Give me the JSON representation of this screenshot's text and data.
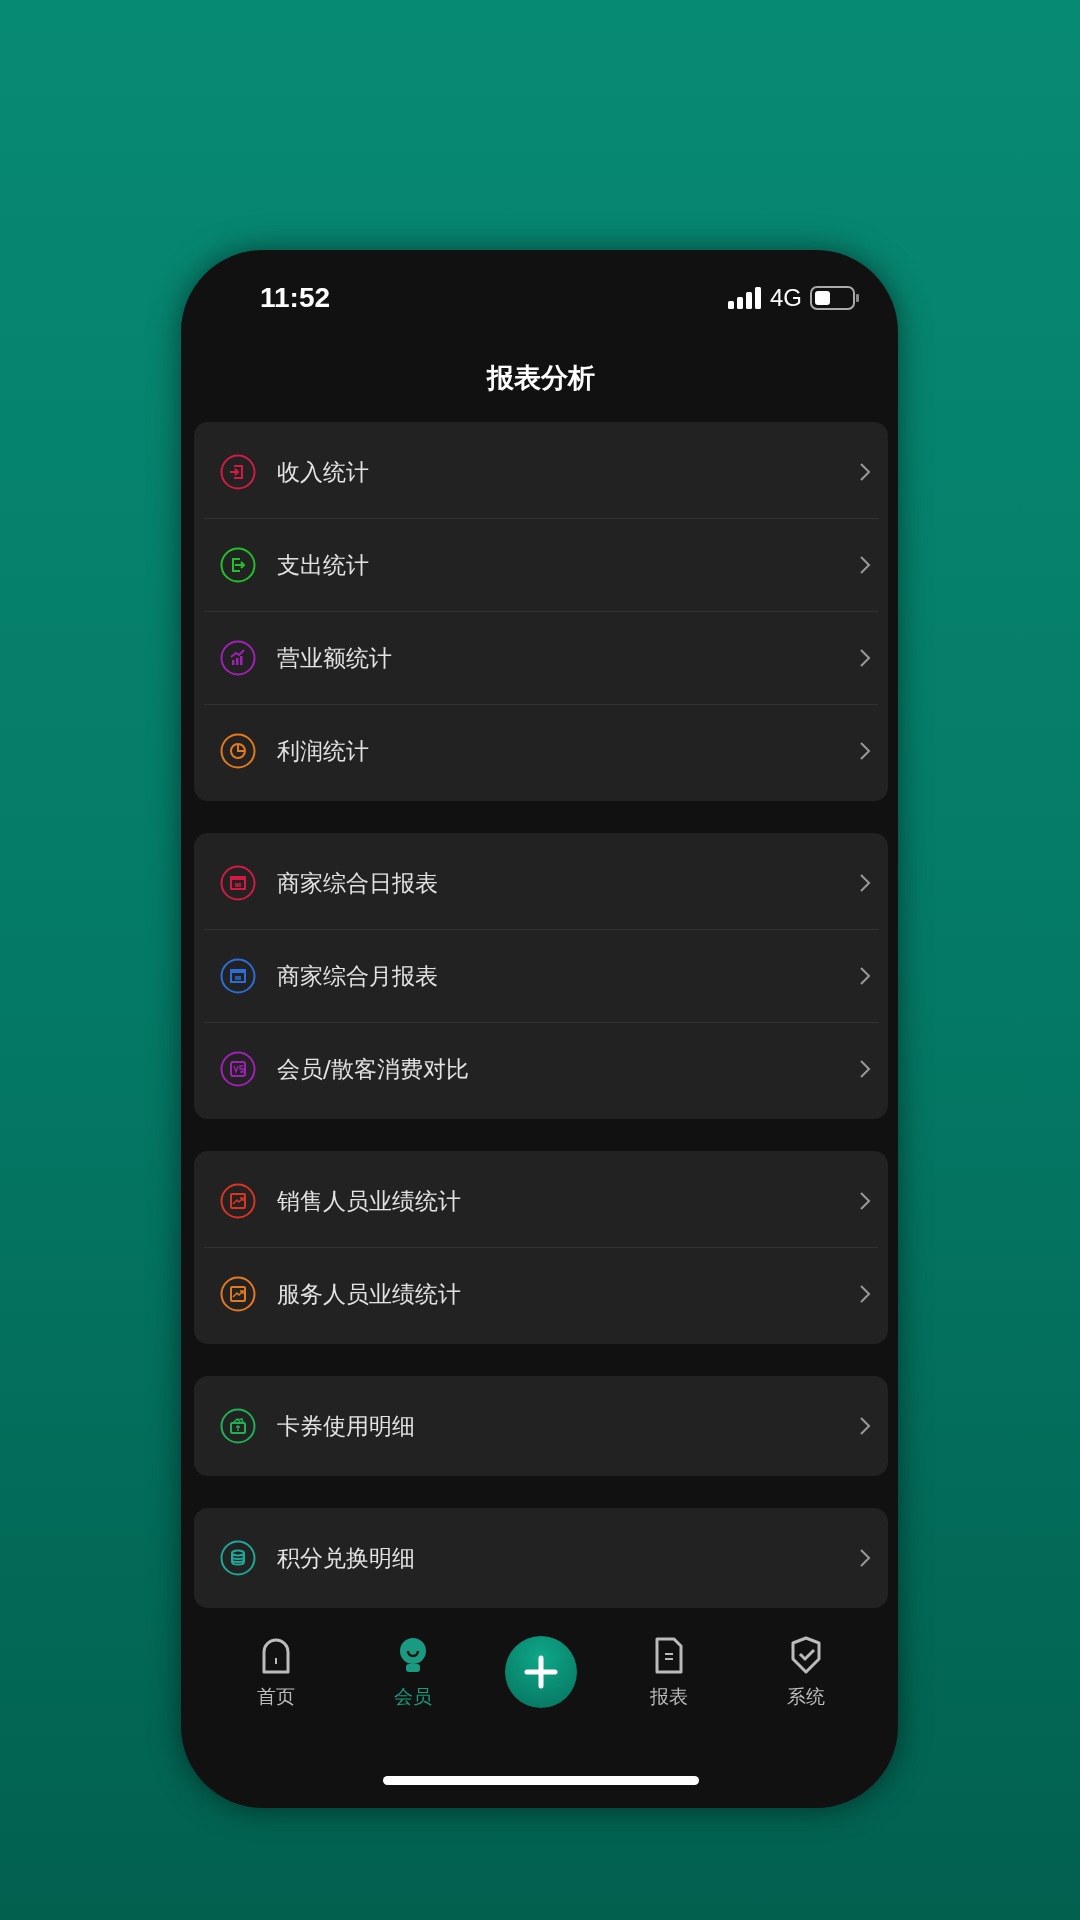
{
  "status_bar": {
    "time": "11:52",
    "network": "4G"
  },
  "header": {
    "title": "报表分析"
  },
  "groups": [
    {
      "items": [
        {
          "label": "收入统计",
          "color": "#d41a44",
          "kind": "enter"
        },
        {
          "label": "支出统计",
          "color": "#22c02a",
          "kind": "exit"
        },
        {
          "label": "营业额统计",
          "color": "#a320b8",
          "kind": "growth"
        },
        {
          "label": "利润统计",
          "color": "#e47a1e",
          "kind": "pie"
        }
      ]
    },
    {
      "items": [
        {
          "label": "商家综合日报表",
          "color": "#d41a44",
          "kind": "sheet"
        },
        {
          "label": "商家综合月报表",
          "color": "#2a6ed8",
          "kind": "sheet"
        },
        {
          "label": "会员/散客消费对比",
          "color": "#a320b8",
          "kind": "vs"
        }
      ]
    },
    {
      "items": [
        {
          "label": "销售人员业绩统计",
          "color": "#dc3420",
          "kind": "trend"
        },
        {
          "label": "服务人员业绩统计",
          "color": "#e47a1e",
          "kind": "trend"
        }
      ]
    },
    {
      "items": [
        {
          "label": "卡券使用明细",
          "color": "#20b055",
          "kind": "wallet"
        }
      ]
    },
    {
      "items": [
        {
          "label": "积分兑换明细",
          "color": "#1ea898",
          "kind": "coins"
        }
      ]
    }
  ],
  "tab_bar": [
    {
      "label": "首页",
      "selected": false,
      "kind": "home"
    },
    {
      "label": "会员",
      "selected": true,
      "kind": "member"
    },
    {
      "kind": "add",
      "selected": false
    },
    {
      "label": "报表",
      "selected": false,
      "kind": "report"
    },
    {
      "label": "系统",
      "selected": false,
      "kind": "system"
    }
  ]
}
